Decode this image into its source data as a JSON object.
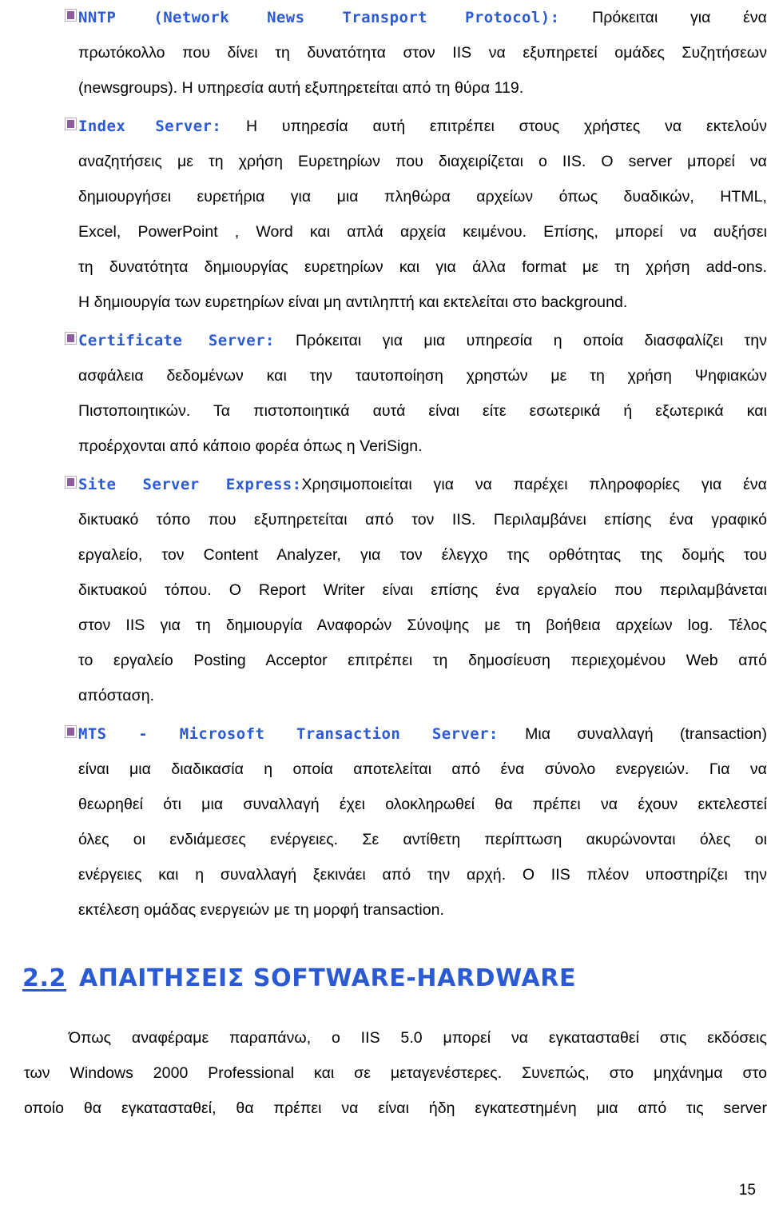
{
  "document": {
    "language": "Greek",
    "page_number": "15",
    "colors": {
      "heading_blue": "#2a5ad4",
      "bullet_purple": "#8d5e9e",
      "body_text": "#000000",
      "page_background": "#ffffff"
    }
  },
  "bullets": [
    {
      "icon": "purple-square-bullet-icon",
      "lead": "NNTP (Network News Transport Protocol):",
      "lines": [
        "Πρόκειται για ένα",
        "πρωτόκολλο που δίνει τη δυνατότητα στον IIS να εξυπηρετεί ομάδες Συζητήσεων",
        "(newsgroups). Η υπηρεσία αυτή εξυπηρετείται από τη θύρα 119."
      ]
    },
    {
      "icon": "purple-square-bullet-icon",
      "lead": "Index Server:",
      "lines": [
        "Η υπηρεσία αυτή επιτρέπει στους χρήστες να εκτελούν",
        "αναζητήσεις με τη χρήση Ευρετηρίων που διαχειρίζεται ο IIS. Ο server μπορεί να",
        "δημιουργήσει ευρετήρια για μια πληθώρα αρχείων όπως δυαδικών, HTML,",
        "Excel, PowerPoint , Word  και απλά αρχεία κειμένου. Επίσης, μπορεί να αυξήσει",
        "τη δυνατότητα δημιουργίας ευρετηρίων και για άλλα format με τη χρήση add-ons.",
        "Η δημιουργία των ευρετηρίων είναι μη αντιληπτή και εκτελείται στο background."
      ]
    },
    {
      "icon": "purple-square-bullet-icon",
      "lead": "Certificate Server:",
      "lines": [
        "Πρόκειται για μια υπηρεσία η οποία διασφαλίζει την",
        "ασφάλεια δεδομένων και την ταυτοποίηση χρηστών με τη χρήση Ψηφιακών",
        "Πιστοποιητικών. Τα πιστοποιητικά αυτά είναι είτε εσωτερικά ή εξωτερικά και",
        "προέρχονται από κάποιο φορέα όπως η VeriSign."
      ]
    },
    {
      "icon": "purple-square-bullet-icon",
      "lead": "Site Server Express:",
      "lines": [
        "Χρησιμοποιείται για να παρέχει πληροφορίες για ένα",
        "δικτυακό τόπο που εξυπηρετείται από τον IIS. Περιλαμβάνει επίσης ένα γραφικό",
        "εργαλείο, τον Content Analyzer, για τον έλεγχο της ορθότητας της δομής του",
        "δικτυακού τόπου. Ο  Report Writer είναι επίσης ένα εργαλείο που περιλαμβάνεται",
        "στον IIS για τη δημιουργία Αναφορών Σύνοψης με τη βοήθεια αρχείων log. Τέλος",
        "το εργαλείο Posting Acceptor επιτρέπει τη δημοσίευση περιεχομένου Web από",
        "απόσταση."
      ]
    },
    {
      "icon": "purple-square-bullet-icon",
      "lead": "MTS - Microsoft Transaction Server:",
      "lines": [
        "Μια συναλλαγή (transaction)",
        "είναι μια διαδικασία η οποία αποτελείται από ένα σύνολο ενεργειών. Για να",
        "θεωρηθεί ότι μια συναλλαγή έχει ολοκληρωθεί θα πρέπει να έχουν εκτελεστεί",
        "όλες οι ενδιάμεσες ενέργειες. Σε αντίθετη περίπτωση ακυρώνονται όλες οι",
        "ενέργειες και η συναλλαγή ξεκινάει από την αρχή. Ο IIS πλέον υποστηρίζει την",
        "εκτέλεση ομάδας ενεργειών με τη μορφή transaction."
      ]
    }
  ],
  "section": {
    "number": "2.2",
    "title": "ΑΠΑΙΤΗΣΕΙΣ SOFTWARE-HARDWARE",
    "paragraph_lines": [
      "Όπως αναφέραμε παραπάνω, ο IIS 5.0 μπορεί να εγκατασταθεί στις εκδόσεις",
      "των Windows 2000 Professional και σε μεταγενέστερες. Συνεπώς, στο μηχάνημα στο",
      "οποίο θα εγκατασταθεί, θα πρέπει να είναι ήδη εγκατεστημένη μια από τις server"
    ]
  }
}
